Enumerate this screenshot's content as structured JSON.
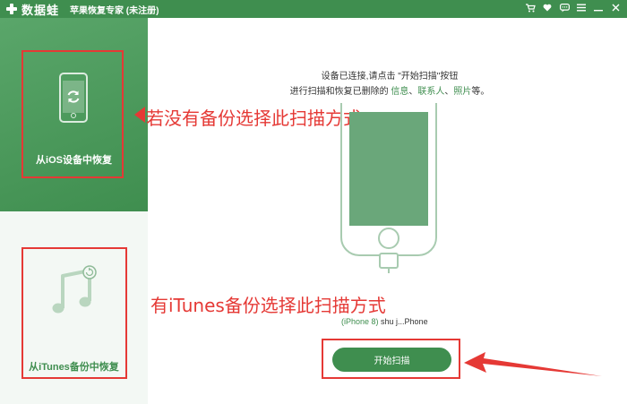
{
  "titlebar": {
    "brand": "数据蛙",
    "title": "苹果恢复专家 (未注册)",
    "controls": [
      "cart-icon",
      "heart-icon",
      "chat-icon",
      "menu-icon",
      "minimize-icon",
      "close-icon"
    ]
  },
  "sidebar": {
    "items": [
      {
        "label": "从iOS设备中恢复",
        "icon": "phone-refresh-icon",
        "active": true
      },
      {
        "label": "从iTunes备份中恢复",
        "icon": "music-note-icon",
        "active": false
      }
    ]
  },
  "main": {
    "instruction_line1": "设备已连接,请点击 \"开始扫描\"按钮",
    "instruction_line2_prefix": "进行扫描和恢复已删除的 ",
    "links": [
      "信息",
      "联系人",
      "照片"
    ],
    "separator": "、",
    "instruction_line2_suffix": "等。",
    "device_model": "(iPhone 8)",
    "device_name": " shu j...Phone",
    "start_button": "开始扫描"
  },
  "annotations": {
    "no_backup": "若没有备份选择此扫描方式",
    "has_itunes": "有iTunes备份选择此扫描方式"
  },
  "colors": {
    "accent": "#3f8e4f",
    "annotation_red": "#e53935",
    "sidebar_bg": "#f3f8f4"
  }
}
